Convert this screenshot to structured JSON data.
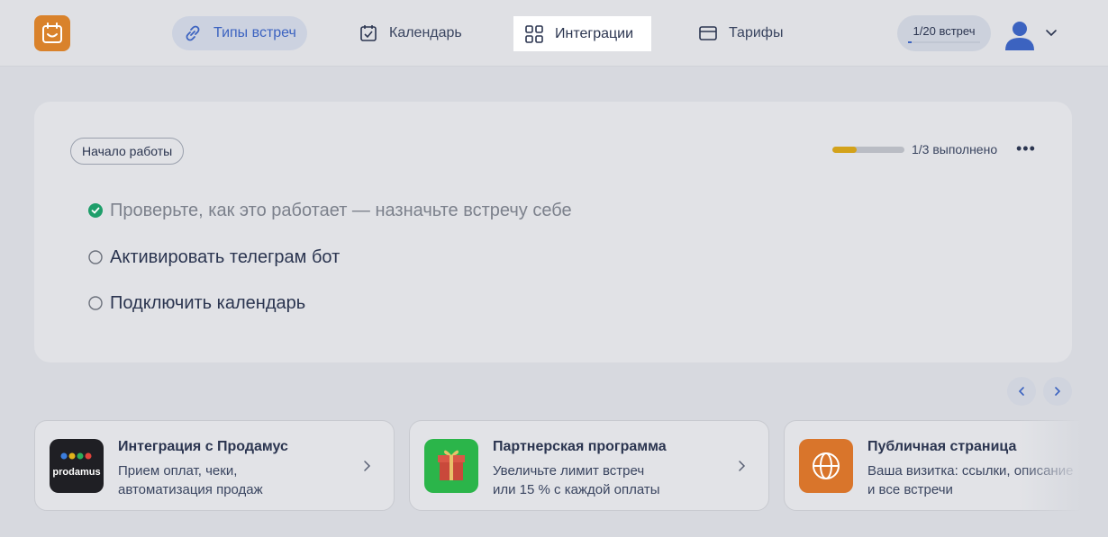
{
  "header": {
    "nav": [
      {
        "label": "Типы встреч",
        "icon": "link-icon"
      },
      {
        "label": "Календарь",
        "icon": "calendar-check-icon"
      },
      {
        "label": "Интеграции",
        "icon": "grid-icon"
      },
      {
        "label": "Тарифы",
        "icon": "card-icon"
      }
    ],
    "meetings_counter": "1/20 встреч",
    "meetings_progress": 0.05
  },
  "onboarding": {
    "chip_label": "Начало работы",
    "progress_text": "1/3 выполнено",
    "progress": 0.333,
    "tasks": [
      {
        "label": "Проверьте, как это работает — назначьте встречу себе",
        "done": true
      },
      {
        "label": "Активировать телеграм бот",
        "done": false
      },
      {
        "label": "Подключить календарь",
        "done": false
      }
    ]
  },
  "features": [
    {
      "title": "Интеграция с Продамус",
      "desc1": "Прием оплат, чеки,",
      "desc2": "автоматизация продаж",
      "logo_text": "prodamus"
    },
    {
      "title": "Партнерская программа",
      "desc1": "Увеличьте лимит встреч",
      "desc2": "или 15 % с каждой оплаты"
    },
    {
      "title": "Публичная страница",
      "desc1": "Ваша визитка: ссылки, описание",
      "desc2": "и все встречи"
    }
  ],
  "colors": {
    "accent": "#3c63c0",
    "progress": "#d3a21a",
    "done": "#1e9e6a",
    "logo_bg": "#d9822b"
  }
}
